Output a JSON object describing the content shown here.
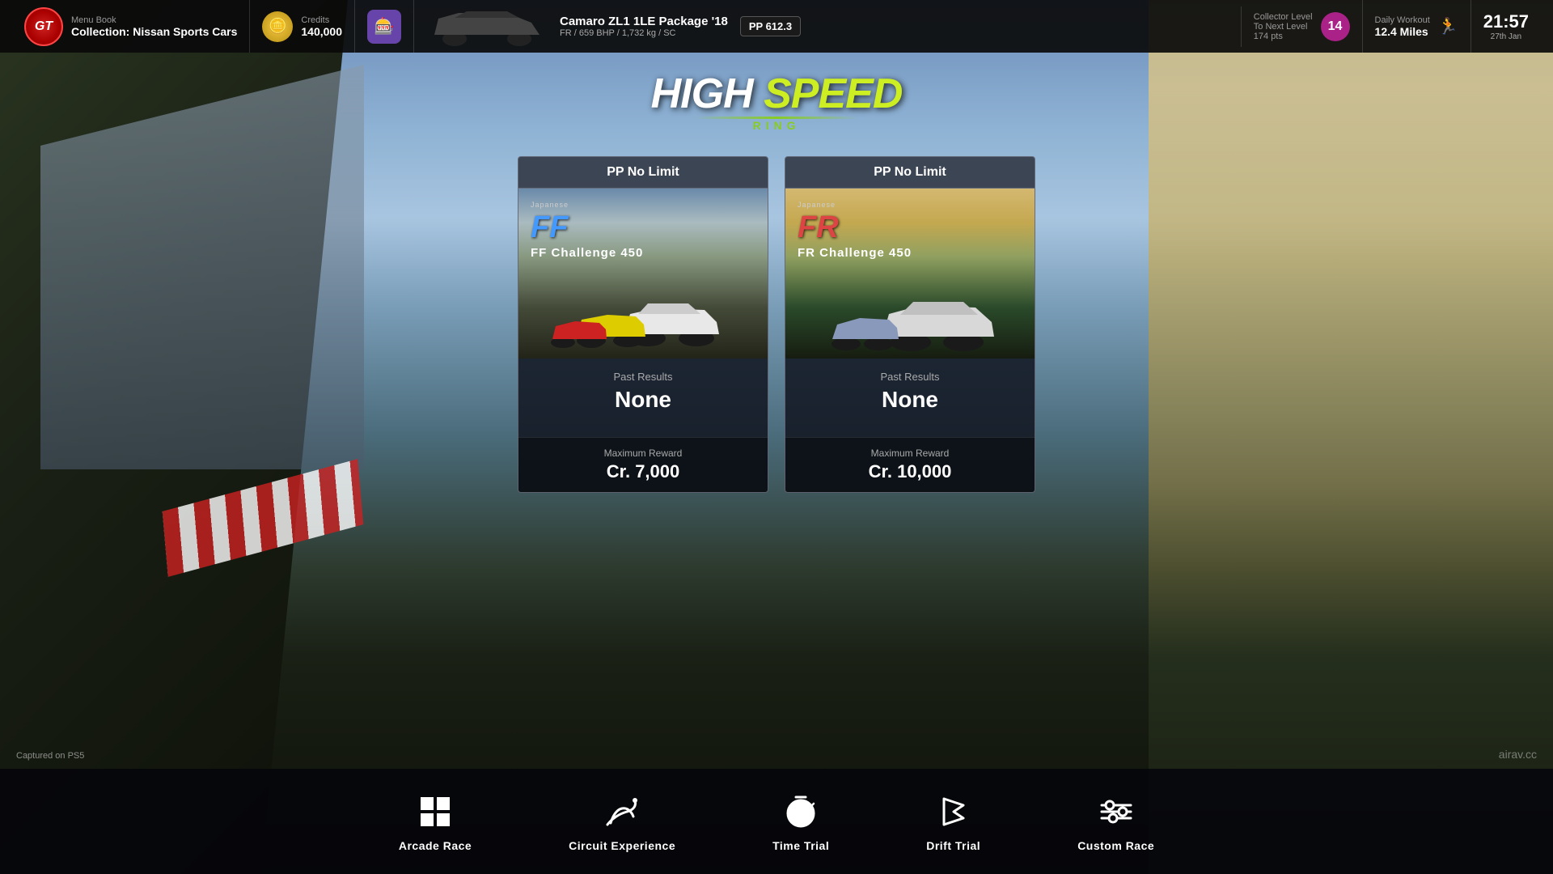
{
  "header": {
    "gt_logo": "GT",
    "menu_label": "Menu Book",
    "collection_name": "Collection: Nissan Sports Cars",
    "credits_label": "Credits",
    "credits_value": "140,000",
    "car_name": "Camaro ZL1 1LE Package '18",
    "car_specs": "FR / 659 BHP / 1,732 kg / SC",
    "pp_value": "PP 612.3",
    "collector_label": "Collector Level",
    "collector_sublabel": "To Next Level",
    "collector_pts": "174 pts",
    "collector_level": "14",
    "workout_label": "Daily Workout",
    "workout_value": "12.4 Miles",
    "workout_date": "27th Jan",
    "timer_value": "21:57"
  },
  "track": {
    "logo_part1": "HIGH",
    "logo_part2": "SPEED",
    "logo_sub": "RING"
  },
  "races": [
    {
      "id": "ff-challenge",
      "pp_limit": "PP No Limit",
      "category_type": "FF",
      "category_label": "Japanese",
      "challenge_name": "FF Challenge 450",
      "past_results_label": "Past Results",
      "past_results_value": "None",
      "max_reward_label": "Maximum Reward",
      "max_reward_value": "Cr.  7,000"
    },
    {
      "id": "fr-challenge",
      "pp_limit": "PP No Limit",
      "category_type": "FR",
      "category_label": "Japanese",
      "challenge_name": "FR Challenge 450",
      "past_results_label": "Past Results",
      "past_results_value": "None",
      "max_reward_label": "Maximum Reward",
      "max_reward_value": "Cr.  10,000"
    }
  ],
  "nav": {
    "items": [
      {
        "id": "arcade-race",
        "label": "Arcade Race"
      },
      {
        "id": "circuit-experience",
        "label": "Circuit Experience"
      },
      {
        "id": "time-trial",
        "label": "Time Trial"
      },
      {
        "id": "drift-trial",
        "label": "Drift Trial"
      },
      {
        "id": "custom-race",
        "label": "Custom Race"
      }
    ]
  },
  "footer": {
    "captured": "Captured on PS5",
    "watermark": "airav.cc"
  }
}
